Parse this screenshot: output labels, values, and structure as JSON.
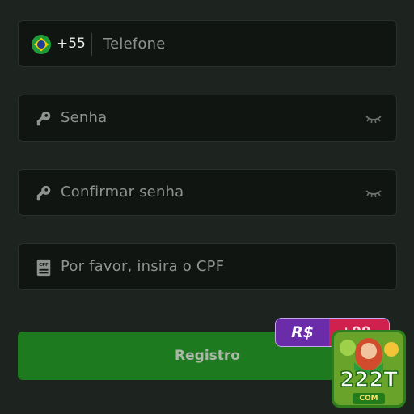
{
  "phone": {
    "country_code": "+55",
    "placeholder": "Telefone",
    "flag": "brazil-flag-icon"
  },
  "password": {
    "placeholder": "Senha",
    "icon": "key-icon",
    "toggle_icon": "eye-closed-icon"
  },
  "confirm_password": {
    "placeholder": "Confirmar senha",
    "icon": "key-icon",
    "toggle_icon": "eye-closed-icon"
  },
  "cpf": {
    "placeholder": "Por favor, insira o CPF",
    "icon": "cpf-card-icon"
  },
  "register": {
    "label": "Registro"
  },
  "promo": {
    "currency": "R$",
    "amount": "+99"
  },
  "logo": {
    "number": "222T",
    "suffix": "COM"
  },
  "colors": {
    "background": "#1d231f",
    "field": "#111512",
    "button": "#1e7a1f",
    "promo_left": "#6a2ca8",
    "promo_right": "#d0204d"
  }
}
